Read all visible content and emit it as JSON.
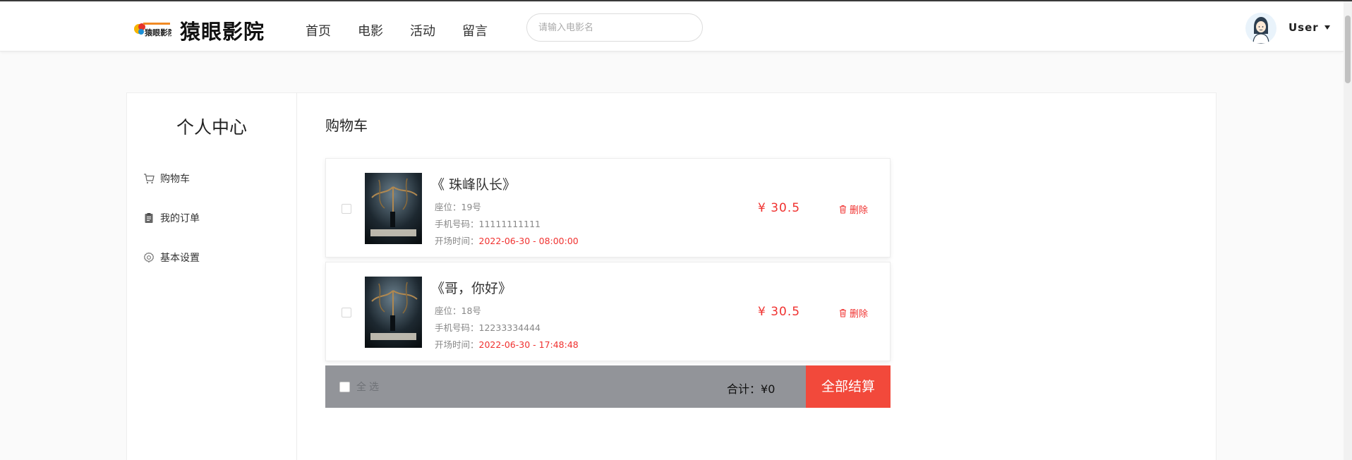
{
  "header": {
    "logo_text": "猿眼影院",
    "brand": "猿眼影院",
    "nav": [
      "首页",
      "电影",
      "活动",
      "留言"
    ],
    "search_placeholder": "请输入电影名",
    "user_name": "User"
  },
  "sidebar": {
    "title": "个人中心",
    "items": [
      {
        "label": "购物车",
        "icon": "cart-icon"
      },
      {
        "label": "我的订单",
        "icon": "clipboard-icon"
      },
      {
        "label": "基本设置",
        "icon": "gear-icon"
      }
    ]
  },
  "main": {
    "title": "购物车",
    "cart": [
      {
        "title": "《 珠峰队长》",
        "seat_label": "座位：",
        "seat": "19号",
        "phone_label": "手机号码：",
        "phone": "11111111111",
        "time_label": "开场时间：",
        "time": "2022-06-30 - 08:00:00",
        "price": "¥ 30.5",
        "delete_label": "删除"
      },
      {
        "title": "《哥，你好》",
        "seat_label": "座位：",
        "seat": "18号",
        "phone_label": "手机号码：",
        "phone": "12233334444",
        "time_label": "开场时间：",
        "time": "2022-06-30 - 17:48:48",
        "price": "¥ 30.5",
        "delete_label": "删除"
      }
    ],
    "footer": {
      "select_all": "全选",
      "total_label": "合计：",
      "total": "¥0",
      "checkout": "全部结算"
    }
  },
  "colors": {
    "accent_red": "#f0312f",
    "checkout_bg": "#f2493b",
    "footer_bg": "#929499"
  }
}
